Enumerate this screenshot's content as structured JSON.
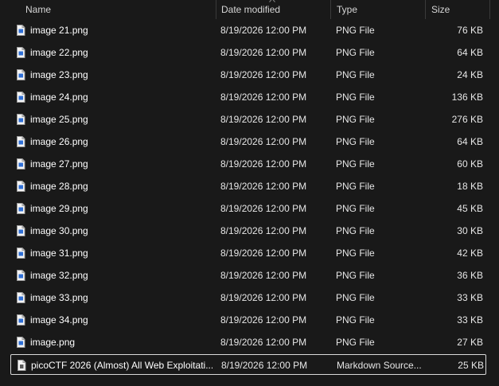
{
  "columns": {
    "name": "Name",
    "date_modified": "Date modified",
    "type": "Type",
    "size": "Size"
  },
  "files": [
    {
      "name": "image 21.png",
      "date": "8/19/2026 12:00 PM",
      "type": "PNG File",
      "size": "76 KB",
      "icon": "png-file-icon"
    },
    {
      "name": "image 22.png",
      "date": "8/19/2026 12:00 PM",
      "type": "PNG File",
      "size": "64 KB",
      "icon": "png-file-icon"
    },
    {
      "name": "image 23.png",
      "date": "8/19/2026 12:00 PM",
      "type": "PNG File",
      "size": "24 KB",
      "icon": "png-file-icon"
    },
    {
      "name": "image 24.png",
      "date": "8/19/2026 12:00 PM",
      "type": "PNG File",
      "size": "136 KB",
      "icon": "png-file-icon"
    },
    {
      "name": "image 25.png",
      "date": "8/19/2026 12:00 PM",
      "type": "PNG File",
      "size": "276 KB",
      "icon": "png-file-icon"
    },
    {
      "name": "image 26.png",
      "date": "8/19/2026 12:00 PM",
      "type": "PNG File",
      "size": "64 KB",
      "icon": "png-file-icon"
    },
    {
      "name": "image 27.png",
      "date": "8/19/2026 12:00 PM",
      "type": "PNG File",
      "size": "60 KB",
      "icon": "png-file-icon"
    },
    {
      "name": "image 28.png",
      "date": "8/19/2026 12:00 PM",
      "type": "PNG File",
      "size": "18 KB",
      "icon": "png-file-icon"
    },
    {
      "name": "image 29.png",
      "date": "8/19/2026 12:00 PM",
      "type": "PNG File",
      "size": "45 KB",
      "icon": "png-file-icon"
    },
    {
      "name": "image 30.png",
      "date": "8/19/2026 12:00 PM",
      "type": "PNG File",
      "size": "30 KB",
      "icon": "png-file-icon"
    },
    {
      "name": "image 31.png",
      "date": "8/19/2026 12:00 PM",
      "type": "PNG File",
      "size": "42 KB",
      "icon": "png-file-icon"
    },
    {
      "name": "image 32.png",
      "date": "8/19/2026 12:00 PM",
      "type": "PNG File",
      "size": "36 KB",
      "icon": "png-file-icon"
    },
    {
      "name": "image 33.png",
      "date": "8/19/2026 12:00 PM",
      "type": "PNG File",
      "size": "33 KB",
      "icon": "png-file-icon"
    },
    {
      "name": "image 34.png",
      "date": "8/19/2026 12:00 PM",
      "type": "PNG File",
      "size": "33 KB",
      "icon": "png-file-icon"
    },
    {
      "name": "image.png",
      "date": "8/19/2026 12:00 PM",
      "type": "PNG File",
      "size": "27 KB",
      "icon": "png-file-icon"
    },
    {
      "name": "picoCTF 2026 (Almost) All Web Exploitati...",
      "date": "8/19/2026 12:00 PM",
      "type": "Markdown Source...",
      "size": "25 KB",
      "icon": "markdown-file-icon",
      "selected": true
    }
  ],
  "colors": {
    "background": "#191919",
    "text": "#ffffff",
    "selection_border": "#d9d9d9"
  }
}
